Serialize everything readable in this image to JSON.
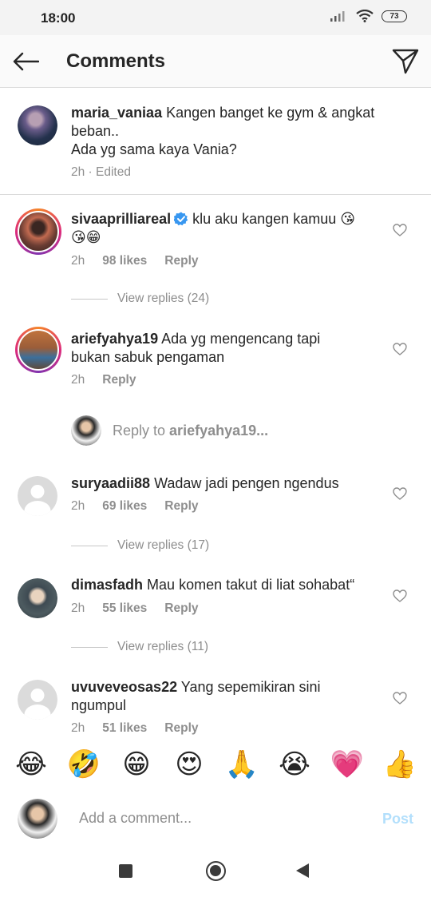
{
  "status_bar": {
    "time": "18:00",
    "battery": "73"
  },
  "header": {
    "title": "Comments",
    "back_icon": "arrow-left-icon",
    "direct_icon": "paper-plane-icon"
  },
  "caption": {
    "username": "maria_vaniaa",
    "text": "Kangen banget ke gym & angkat beban..",
    "text2": "Ada yg sama kaya Vania?",
    "meta": "2h · Edited"
  },
  "comments": [
    {
      "username": "sivaaprilliareal",
      "verified": true,
      "text": "klu aku kangen kamuu 😘",
      "text2": "😘😁",
      "time": "2h",
      "likes": "98 likes",
      "reply": "Reply",
      "view_replies": "View replies (24)"
    },
    {
      "username": "ariefyahya19",
      "text": "Ada yg mengencang tapi",
      "text2": "bukan sabuk pengaman",
      "time": "2h",
      "reply": "Reply",
      "reply_to_prefix": "Reply to ",
      "reply_to_user": "ariefyahya19..."
    },
    {
      "username": "suryaadii88",
      "text": "Wadaw jadi pengen ngendus",
      "time": "2h",
      "likes": "69 likes",
      "reply": "Reply",
      "view_replies": "View replies (17)"
    },
    {
      "username": "dimasfadh",
      "text": "Mau komen takut di liat sohabat“",
      "time": "2h",
      "likes": "55 likes",
      "reply": "Reply",
      "view_replies": "View replies (11)"
    },
    {
      "username": "uvuveveosas22",
      "text": "Yang sepemikiran sini",
      "text2": "ngumpul",
      "time": "2h",
      "likes": "51 likes",
      "reply": "Reply"
    }
  ],
  "emoji_bar": [
    "😂",
    "🤣",
    "😁",
    "😍",
    "🙏",
    "😭",
    "💗",
    "👍"
  ],
  "composer": {
    "placeholder": "Add a comment...",
    "post_label": "Post"
  },
  "colors": {
    "text": "#262626",
    "secondary": "#8e8e8e",
    "post_disabled": "#b2dffc",
    "verified": "#3897f0"
  }
}
